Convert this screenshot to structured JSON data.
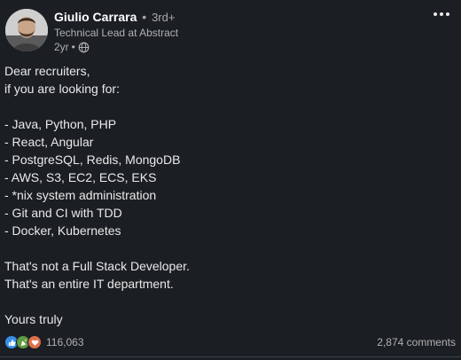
{
  "author": {
    "name": "Giulio Carrara",
    "degree": "3rd+",
    "separator": "•",
    "headline": "Technical Lead at Abstract",
    "time": "2yr",
    "time_separator": "•",
    "visibility_icon": "globe-icon"
  },
  "post": {
    "lines": [
      "Dear recruiters,",
      "if you are looking for:",
      "",
      "- Java, Python, PHP",
      "- React, Angular",
      "- PostgreSQL, Redis, MongoDB",
      "- AWS, S3, EC2, ECS, EKS",
      "- *nix system administration",
      "- Git and CI with TDD",
      "- Docker, Kubernetes",
      "",
      "That's not a Full Stack Developer.",
      "That's an entire IT department.",
      "",
      "Yours truly"
    ]
  },
  "footer": {
    "reaction_icons": [
      "like-icon",
      "celebrate-icon",
      "love-icon"
    ],
    "reaction_count": "116,063",
    "comments": "2,874 comments"
  },
  "colors": {
    "background": "#1b1f23",
    "text": "#e9e9e9",
    "muted": "#b0b0b0",
    "like": "#378fe9",
    "celebrate": "#5f9b41",
    "love": "#df704d"
  }
}
